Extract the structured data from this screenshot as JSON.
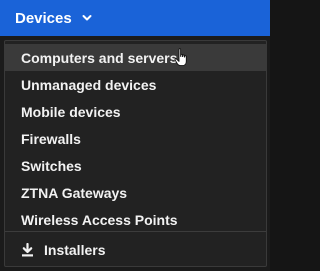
{
  "nav": {
    "label": "Devices",
    "chevron_icon": "chevron-down-icon",
    "bar_color": "#1a63d8"
  },
  "menu": {
    "items": [
      {
        "label": "Computers and servers"
      },
      {
        "label": "Unmanaged devices"
      },
      {
        "label": "Mobile devices"
      },
      {
        "label": "Firewalls"
      },
      {
        "label": "Switches"
      },
      {
        "label": "ZTNA Gateways"
      },
      {
        "label": "Wireless Access Points"
      }
    ],
    "installers": {
      "label": "Installers",
      "icon": "download-icon"
    }
  }
}
